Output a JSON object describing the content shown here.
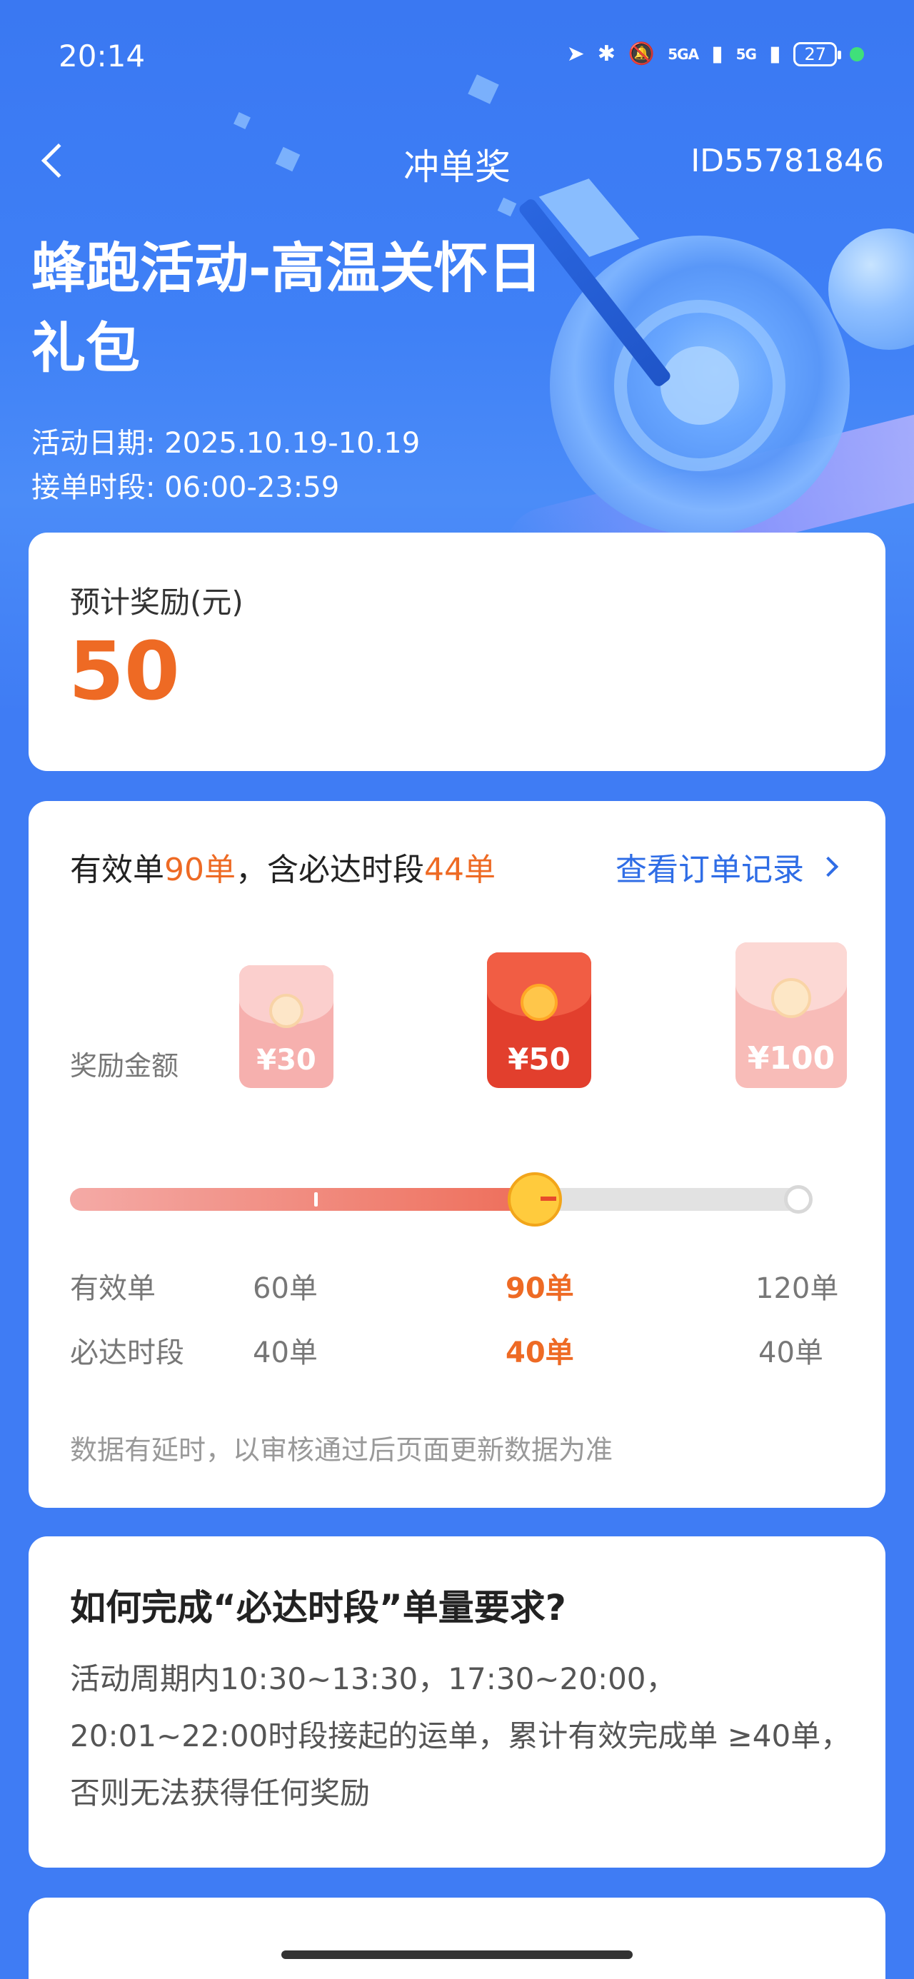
{
  "status_bar": {
    "time": "20:14",
    "network1": "5GA",
    "network2": "5G",
    "battery": "27"
  },
  "nav": {
    "title": "冲单奖",
    "id_text": "ID55781846"
  },
  "hero": {
    "title": "蜂跑活动-高温关怀日礼包",
    "date_line": "活动日期: 2025.10.19-10.19",
    "time_line": "接单时段: 06:00-23:59"
  },
  "reward_summary": {
    "label": "预计奖励(元)",
    "amount": "50"
  },
  "progress_card": {
    "head_prefix": "有效单",
    "head_orders": "90单",
    "head_mid": "，含必达时段",
    "head_required": "44单",
    "link_label": "查看订单记录",
    "reward_label": "奖励金额",
    "tiers": [
      {
        "reward": "¥30",
        "valid_orders": "60单",
        "required_orders": "40单"
      },
      {
        "reward": "¥50",
        "valid_orders": "90单",
        "required_orders": "40单"
      },
      {
        "reward": "¥100",
        "valid_orders": "120单",
        "required_orders": "40单"
      }
    ],
    "row_label_valid": "有效单",
    "row_label_required": "必达时段",
    "progress_fraction": 0.63,
    "note": "数据有延时，以审核通过后页面更新数据为准"
  },
  "howto_card": {
    "title": "如何完成“必达时段”单量要求?",
    "body": "活动周期内10:30~13:30，17:30~20:00，20:01~22:00时段接起的运单，累计有效完成单 ≥40单，否则无法获得任何奖励"
  },
  "colors": {
    "primary_blue": "#3f7cf4",
    "accent_orange": "#ee6a24",
    "link_blue": "#2f6de6"
  }
}
